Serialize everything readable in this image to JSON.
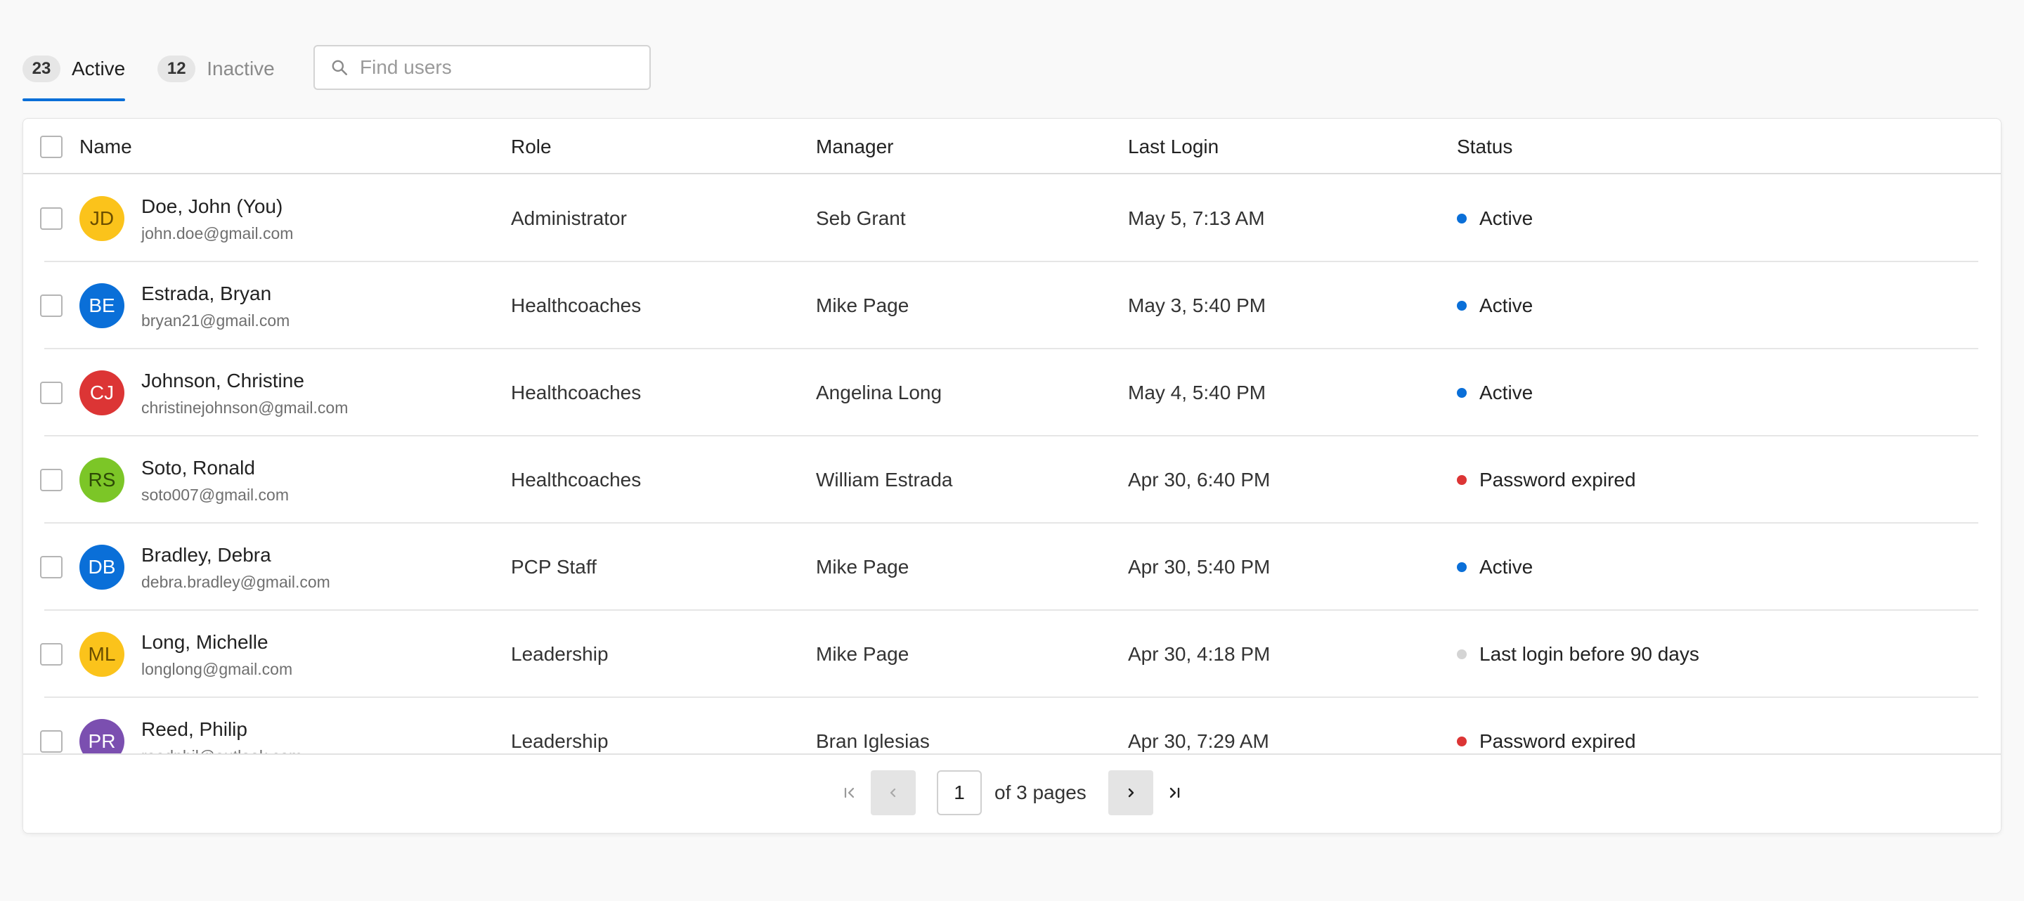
{
  "tabs": [
    {
      "count": "23",
      "label": "Active"
    },
    {
      "count": "12",
      "label": "Inactive"
    }
  ],
  "search": {
    "placeholder": "Find users",
    "value": ""
  },
  "table": {
    "columns": [
      "Name",
      "Role",
      "Manager",
      "Last Login",
      "Status"
    ],
    "rows": [
      {
        "initials": "JD",
        "name": "Doe, John (You)",
        "email": "john.doe@gmail.com",
        "role": "Administrator",
        "manager": "Seb Grant",
        "last_login": "May 5, 7:13 AM",
        "status": "Active",
        "avatar_color": "#fbc31b",
        "avatar_text_color": "#6b4e00",
        "status_color": "#0a6fd8"
      },
      {
        "initials": "BE",
        "name": "Estrada, Bryan",
        "email": "bryan21@gmail.com",
        "role": "Healthcoaches",
        "manager": "Mike Page",
        "last_login": "May 3, 5:40 PM",
        "status": "Active",
        "avatar_color": "#0a6fd8",
        "avatar_text_color": "#ffffff",
        "status_color": "#0a6fd8"
      },
      {
        "initials": "CJ",
        "name": "Johnson, Christine",
        "email": "christinejohnson@gmail.com",
        "role": "Healthcoaches",
        "manager": "Angelina Long",
        "last_login": "May 4, 5:40 PM",
        "status": "Active",
        "avatar_color": "#dc3535",
        "avatar_text_color": "#ffffff",
        "status_color": "#0a6fd8"
      },
      {
        "initials": "RS",
        "name": "Soto, Ronald",
        "email": "soto007@gmail.com",
        "role": "Healthcoaches",
        "manager": "William Estrada",
        "last_login": "Apr 30, 6:40 PM",
        "status": "Password expired",
        "avatar_color": "#7cc627",
        "avatar_text_color": "#2d4a06",
        "status_color": "#dc3535"
      },
      {
        "initials": "DB",
        "name": "Bradley, Debra",
        "email": "debra.bradley@gmail.com",
        "role": "PCP Staff",
        "manager": "Mike Page",
        "last_login": "Apr 30, 5:40 PM",
        "status": "Active",
        "avatar_color": "#0a6fd8",
        "avatar_text_color": "#ffffff",
        "status_color": "#0a6fd8"
      },
      {
        "initials": "ML",
        "name": "Long, Michelle",
        "email": "longlong@gmail.com",
        "role": "Leadership",
        "manager": "Mike Page",
        "last_login": "Apr 30, 4:18 PM",
        "status": "Last login before 90 days",
        "avatar_color": "#fbc31b",
        "avatar_text_color": "#6b4e00",
        "status_color": "#d4d4d4"
      },
      {
        "initials": "PR",
        "name": "Reed, Philip",
        "email": "reedphil@outlook.com",
        "role": "Leadership",
        "manager": "Bran Iglesias",
        "last_login": "Apr 30, 7:29 AM",
        "status": "Password expired",
        "avatar_color": "#7b4fb0",
        "avatar_text_color": "#ffffff",
        "status_color": "#dc3535"
      }
    ]
  },
  "pagination": {
    "current_page": "1",
    "of_pages": "of 3 pages"
  },
  "colors": {
    "accent": "#0a6fd8",
    "active_dot": "#0a6fd8",
    "expired_dot": "#dc3535",
    "stale_dot": "#d4d4d4"
  }
}
